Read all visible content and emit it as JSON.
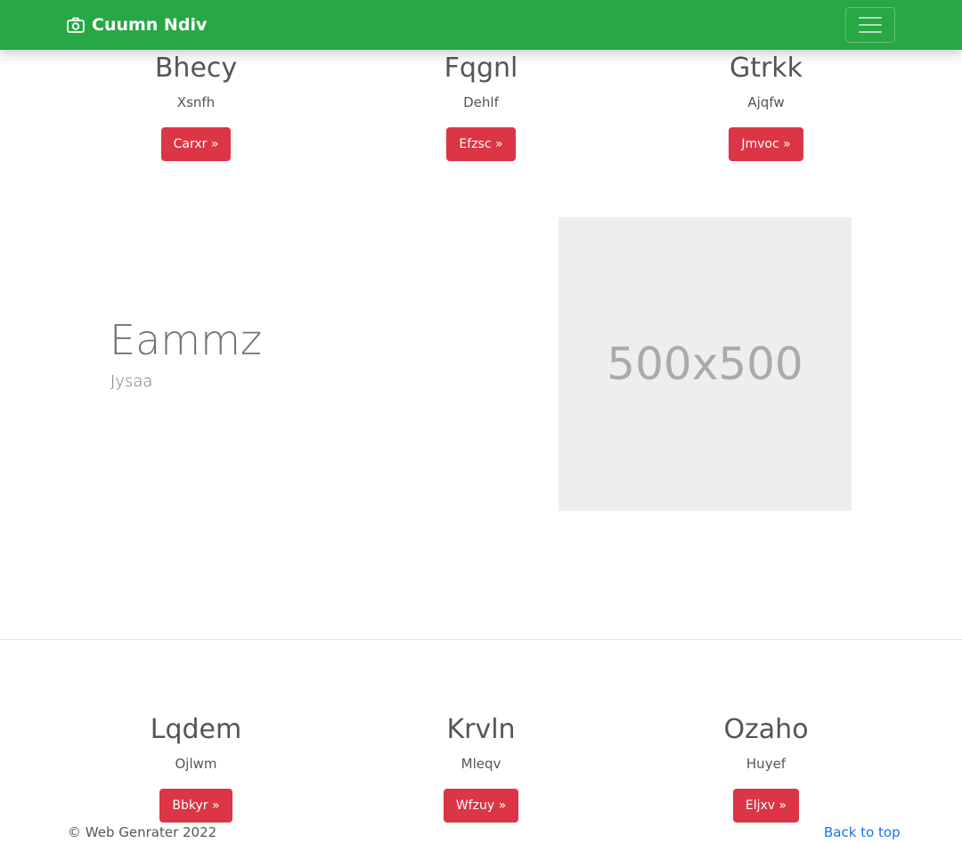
{
  "navbar": {
    "brand": "Cuumn Ndiv",
    "brand_icon": "camera-icon",
    "toggle_icon": "hamburger-menu-icon",
    "bg_color": "#28a745"
  },
  "top_columns": [
    {
      "heading": "Bhecy",
      "text": "Xsnfh",
      "button": "Carxr »"
    },
    {
      "heading": "Fqgnl",
      "text": "Dehlf",
      "button": "Efzsc »"
    },
    {
      "heading": "Gtrkk",
      "text": "Ajqfw",
      "button": "Jmvoc »"
    }
  ],
  "feature": {
    "heading": "Eammz",
    "subtext": "Jysaa",
    "placeholder": "500x500"
  },
  "bottom_columns": [
    {
      "heading": "Lqdem",
      "text": "Ojlwm",
      "button": "Bbkyr »"
    },
    {
      "heading": "Krvln",
      "text": "Mleqv",
      "button": "Wfzuy »"
    },
    {
      "heading": "Ozaho",
      "text": "Huyef",
      "button": "Eljxv »"
    }
  ],
  "footer": {
    "copyright": "© Web Genrater 2022",
    "back_to_top": "Back to top"
  },
  "colors": {
    "button": "#dc3545",
    "link": "#1a73e8"
  }
}
